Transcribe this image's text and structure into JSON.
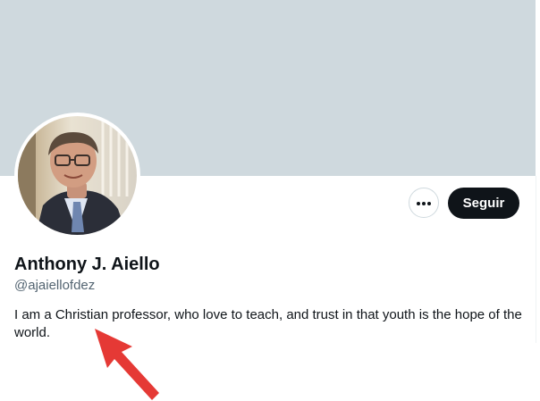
{
  "profile": {
    "display_name": "Anthony J. Aiello",
    "handle": "@ajaiellofdez",
    "bio": "I am a Christian professor, who love to teach, and trust in that youth is the hope of the world."
  },
  "actions": {
    "follow_label": "Seguir",
    "more_icon": "ellipsis-icon"
  },
  "colors": {
    "banner": "#cfd9de",
    "follow_button": "#0f1419",
    "handle_text": "#536471",
    "annotation_arrow": "#e53935"
  }
}
